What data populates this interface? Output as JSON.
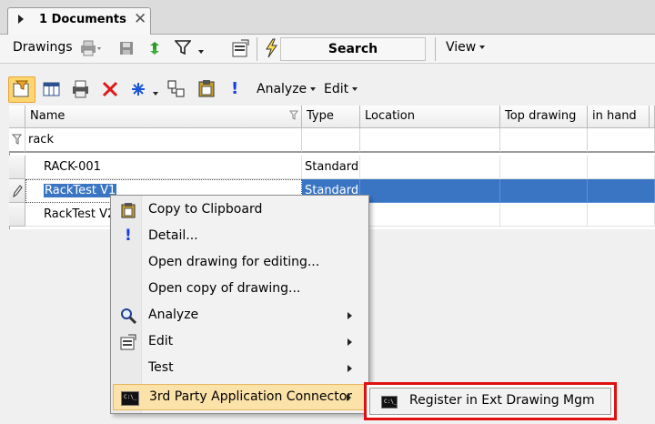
{
  "tab": {
    "label": "1 Documents",
    "close": "✕"
  },
  "toolbar1": {
    "drawings": "Drawings",
    "search": "Search",
    "view": "View"
  },
  "toolbar2": {
    "analyze": "Analyze",
    "edit": "Edit"
  },
  "grid": {
    "columns": [
      "Name",
      "Type",
      "Location",
      "Top drawing",
      "in hand"
    ],
    "filter": "rack",
    "rows": [
      {
        "name": "RACK-001",
        "type": "Standard"
      },
      {
        "name": "RackTest V1",
        "type": "Standard",
        "selected": true
      },
      {
        "name": "RackTest V2",
        "type": ""
      }
    ]
  },
  "context_menu": {
    "items": [
      {
        "label": "Copy to Clipboard",
        "icon": "clipboard-icon"
      },
      {
        "label": "Detail...",
        "icon": "exclamation-icon"
      },
      {
        "label": "Open drawing for editing...",
        "icon": ""
      },
      {
        "label": "Open copy of drawing...",
        "icon": ""
      },
      {
        "label": "Analyze",
        "icon": "magnifier-icon",
        "submenu": true
      },
      {
        "label": "Edit",
        "icon": "properties-icon",
        "submenu": true
      },
      {
        "label": "Test",
        "icon": "",
        "submenu": true
      },
      {
        "label": "3rd Party Application Connector",
        "icon": "console-icon",
        "submenu": true,
        "highlighted": true
      }
    ]
  },
  "submenu": {
    "label": "Register in Ext Drawing Mgm",
    "icon": "console-icon",
    "annotation_color": "#e01010"
  },
  "colors": {
    "selection": "#3a75c4",
    "highlight": "#fbe2a8",
    "active_button": "#ffd56d"
  }
}
